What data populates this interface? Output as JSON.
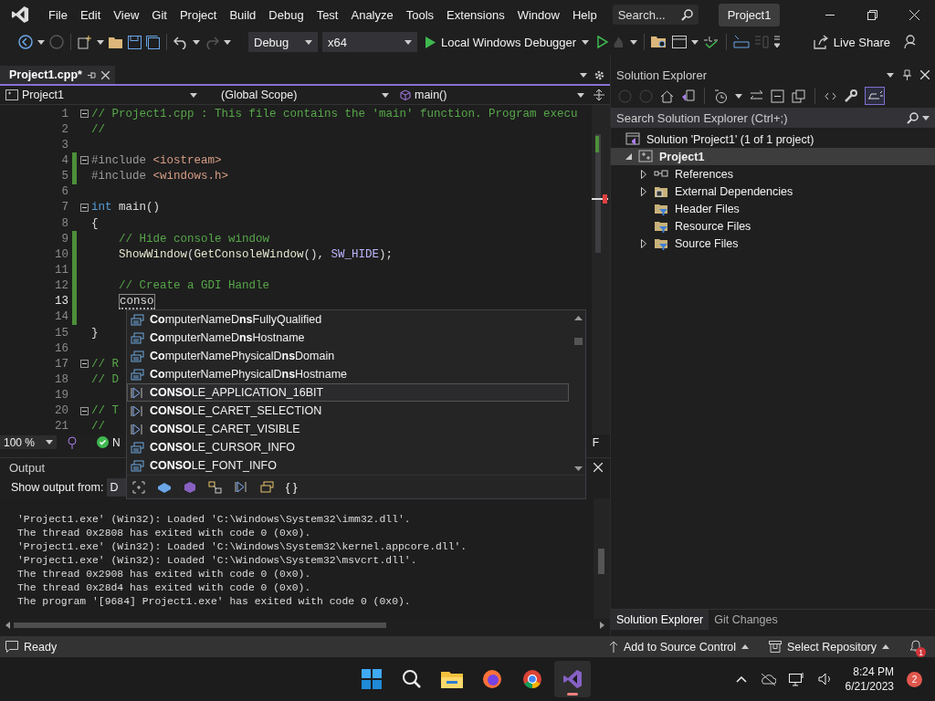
{
  "title_bar": {
    "menu": [
      "File",
      "Edit",
      "View",
      "Git",
      "Project",
      "Build",
      "Debug",
      "Test",
      "Analyze",
      "Tools",
      "Extensions",
      "Window",
      "Help"
    ],
    "search": {
      "placeholder": "Search..."
    },
    "solution_name": "Project1"
  },
  "toolbar": {
    "configuration": "Debug",
    "platform": "x64",
    "run_target": "Local Windows Debugger",
    "live_share": "Live Share"
  },
  "editor": {
    "tabs": [
      {
        "label": "Project1.cpp*",
        "selected": true
      }
    ],
    "nav": {
      "project": "Project1",
      "scope": "(Global Scope)",
      "member": "main()"
    },
    "lines": [
      {
        "n": "1",
        "fold": true,
        "changed": false,
        "current": false,
        "tokens": [
          {
            "kind": "comment",
            "text": "// Project1.cpp : This file contains the 'main' function. Program execu"
          }
        ]
      },
      {
        "n": "2",
        "fold": false,
        "changed": false,
        "current": false,
        "tokens": [
          {
            "kind": "comment",
            "text": "//"
          }
        ]
      },
      {
        "n": "3",
        "fold": false,
        "changed": false,
        "current": false
      },
      {
        "n": "4",
        "fold": true,
        "changed": true,
        "current": false,
        "tokens": [
          {
            "kind": "preproc",
            "text": "#include "
          },
          {
            "kind": "string",
            "text": "<iostream>"
          }
        ]
      },
      {
        "n": "5",
        "fold": false,
        "changed": true,
        "current": false,
        "tokens": [
          {
            "kind": "preproc",
            "text": "#include "
          },
          {
            "kind": "string",
            "text": "<windows.h>"
          }
        ]
      },
      {
        "n": "6",
        "fold": false,
        "changed": false,
        "current": false
      },
      {
        "n": "7",
        "fold": true,
        "changed": false,
        "current": false,
        "tokens": [
          {
            "kind": "keyword",
            "text": "int"
          },
          {
            "kind": "plain",
            "text": " main()"
          }
        ]
      },
      {
        "n": "8",
        "fold": false,
        "changed": false,
        "current": false,
        "tokens": [
          {
            "kind": "plain",
            "text": "{"
          }
        ]
      },
      {
        "n": "9",
        "fold": false,
        "changed": true,
        "current": false,
        "tokens": [
          {
            "kind": "comment",
            "text": "    // Hide console window"
          }
        ]
      },
      {
        "n": "10",
        "fold": false,
        "changed": true,
        "current": false,
        "tokens": [
          {
            "kind": "function",
            "text": "    ShowWindow"
          },
          {
            "kind": "plain",
            "text": "("
          },
          {
            "kind": "function",
            "text": "GetConsoleWindow"
          },
          {
            "kind": "plain",
            "text": "(), "
          },
          {
            "kind": "macro",
            "text": "SW_HIDE"
          },
          {
            "kind": "plain",
            "text": ");"
          }
        ]
      },
      {
        "n": "11",
        "fold": false,
        "changed": true,
        "current": false
      },
      {
        "n": "12",
        "fold": false,
        "changed": true,
        "current": false,
        "tokens": [
          {
            "kind": "comment",
            "text": "    // Create a GDI Handle"
          }
        ]
      },
      {
        "n": "13",
        "fold": false,
        "changed": true,
        "current": true,
        "tokens": [
          {
            "kind": "typed",
            "text": "    conso"
          }
        ]
      },
      {
        "n": "14",
        "fold": false,
        "changed": true,
        "current": false
      },
      {
        "n": "15",
        "fold": false,
        "changed": false,
        "current": false,
        "tokens": [
          {
            "kind": "plain",
            "text": "}"
          }
        ]
      },
      {
        "n": "16",
        "fold": false,
        "changed": false,
        "current": false
      },
      {
        "n": "17",
        "fold": true,
        "changed": false,
        "current": false,
        "tokens": [
          {
            "kind": "comment",
            "text": "// R"
          }
        ]
      },
      {
        "n": "18",
        "fold": false,
        "changed": false,
        "current": false,
        "tokens": [
          {
            "kind": "comment",
            "text": "// D"
          }
        ]
      },
      {
        "n": "19",
        "fold": false,
        "changed": false,
        "current": false
      },
      {
        "n": "20",
        "fold": true,
        "changed": false,
        "current": false,
        "tokens": [
          {
            "kind": "comment",
            "text": "// T"
          }
        ]
      },
      {
        "n": "21",
        "fold": false,
        "changed": false,
        "current": false,
        "tokens": [
          {
            "kind": "comment",
            "text": "//"
          }
        ]
      }
    ],
    "zoom": "100 %",
    "status_text": "N",
    "right_text": "F"
  },
  "completion": {
    "items": [
      {
        "kind": "struct",
        "text": "**Co**mputerNameD**ns**FullyQualified",
        "selected": false
      },
      {
        "kind": "struct",
        "text": "**Co**mputerNameD**ns**Hostname",
        "selected": false
      },
      {
        "kind": "struct",
        "text": "**Co**mputerNamePhysicalD**ns**Domain",
        "selected": false
      },
      {
        "kind": "struct",
        "text": "**Co**mputerNamePhysicalD**ns**Hostname",
        "selected": false
      },
      {
        "kind": "macro",
        "text": "**CONSO**LE_APPLICATION_16BIT",
        "selected": true
      },
      {
        "kind": "macro",
        "text": "**CONSO**LE_CARET_SELECTION",
        "selected": false
      },
      {
        "kind": "macro",
        "text": "**CONSO**LE_CARET_VISIBLE",
        "selected": false
      },
      {
        "kind": "struct",
        "text": "**CONSO**LE_CURSOR_INFO",
        "selected": false
      },
      {
        "kind": "struct",
        "text": "**CONSO**LE_FONT_INFO",
        "selected": false
      }
    ],
    "braces": "{ }"
  },
  "output": {
    "title": "Output",
    "show_output_from": "Show output from:",
    "source": "D",
    "lines": [
      "'Project1.exe' (Win32): Loaded 'C:\\Windows\\System32\\imm32.dll'.",
      "The thread 0x2808 has exited with code 0 (0x0).",
      "'Project1.exe' (Win32): Loaded 'C:\\Windows\\System32\\kernel.appcore.dll'.",
      "'Project1.exe' (Win32): Loaded 'C:\\Windows\\System32\\msvcrt.dll'.",
      "The thread 0x2908 has exited with code 0 (0x0).",
      "The thread 0x28d4 has exited with code 0 (0x0).",
      "The program '[9684] Project1.exe' has exited with code 0 (0x0)."
    ]
  },
  "solution_explorer": {
    "title": "Solution Explorer",
    "search": {
      "placeholder": "Search Solution Explorer (Ctrl+;)"
    },
    "tree": [
      {
        "label": "Solution 'Project1' (1 of 1 project)",
        "kind": "solution",
        "selected": false,
        "children": [
          {
            "label": "Project1",
            "kind": "project",
            "selected": true,
            "expandable": true,
            "expanded": true,
            "children": [
              {
                "label": "References",
                "kind": "references",
                "selected": false,
                "expandable": true,
                "expanded": false
              },
              {
                "label": "External Dependencies",
                "kind": "external",
                "selected": false,
                "expandable": true,
                "expanded": false
              },
              {
                "label": "Header Files",
                "kind": "filter",
                "selected": false,
                "expandable": false
              },
              {
                "label": "Resource Files",
                "kind": "filter",
                "selected": false,
                "expandable": false
              },
              {
                "label": "Source Files",
                "kind": "filter",
                "selected": false,
                "expandable": true,
                "expanded": false
              }
            ]
          }
        ]
      }
    ],
    "tabs": [
      {
        "label": "Solution Explorer",
        "selected": true
      },
      {
        "label": "Git Changes",
        "selected": false
      }
    ]
  },
  "status_bar": {
    "text": "Ready",
    "source_control": "Add to Source Control",
    "repository": "Select Repository",
    "notifications": "1"
  },
  "taskbar": {
    "apps": [
      {
        "kind": "start",
        "active": false
      },
      {
        "kind": "search",
        "active": false
      },
      {
        "kind": "files",
        "active": false
      },
      {
        "kind": "firefox",
        "active": false
      },
      {
        "kind": "chrome",
        "active": false
      },
      {
        "kind": "vs",
        "active": true
      }
    ],
    "time": "8:24 PM",
    "date": "6/21/2023",
    "badge": "2"
  }
}
